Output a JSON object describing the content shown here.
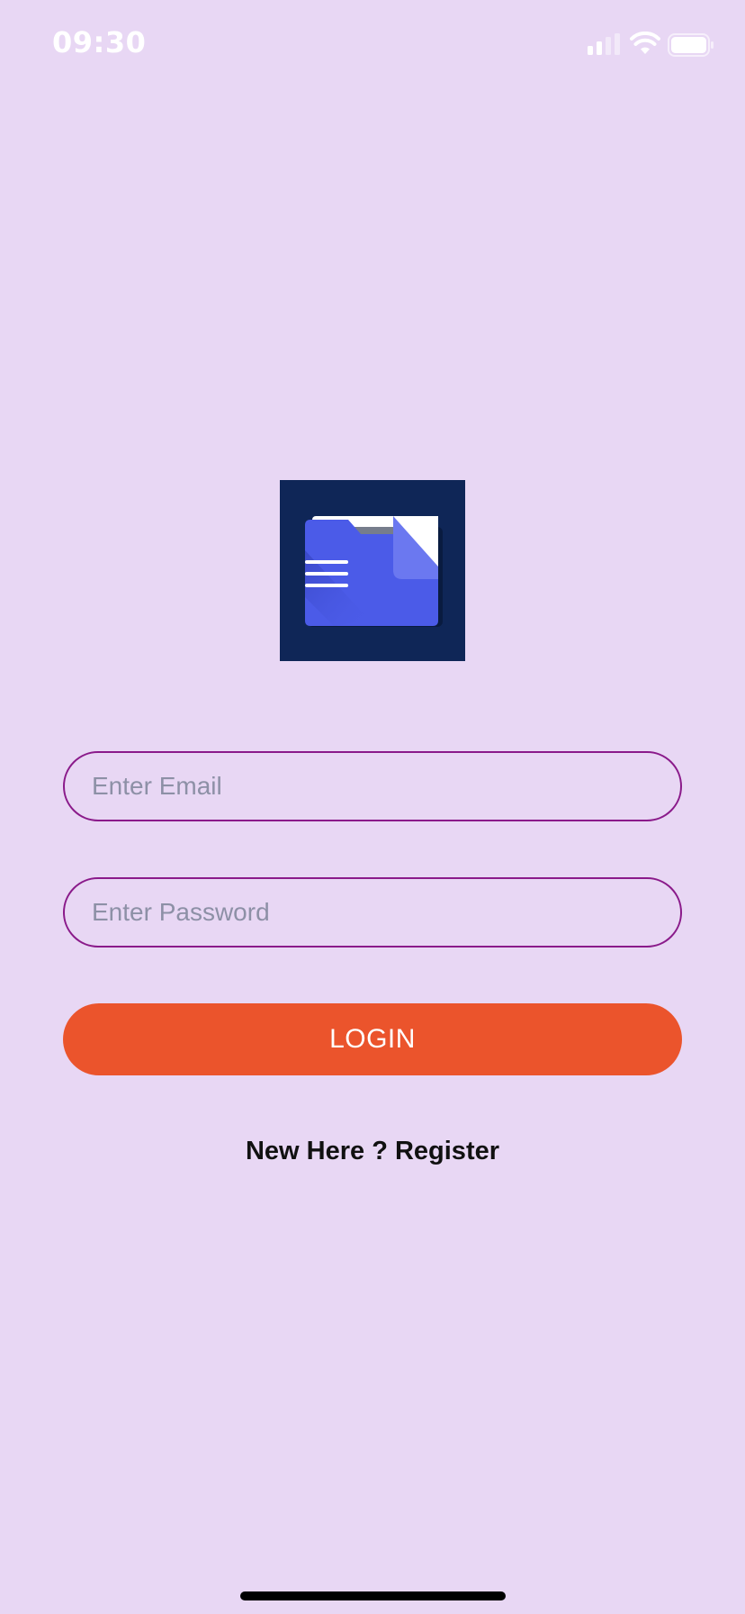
{
  "status_bar": {
    "time": "09:30",
    "signal_icon": "signal-icon",
    "wifi_icon": "wifi-icon",
    "battery_icon": "battery-icon"
  },
  "logo": {
    "icon": "folder-document-icon",
    "background_color": "#0f2657",
    "folder_color": "#4b5be8"
  },
  "form": {
    "email_placeholder": "Enter Email",
    "email_value": "",
    "password_placeholder": "Enter Password",
    "password_value": "",
    "login_label": "LOGIN",
    "register_label": "New Here ? Register"
  },
  "colors": {
    "background": "#e8d7f4",
    "input_border": "#8a1a8a",
    "login_button": "#eb542c"
  }
}
